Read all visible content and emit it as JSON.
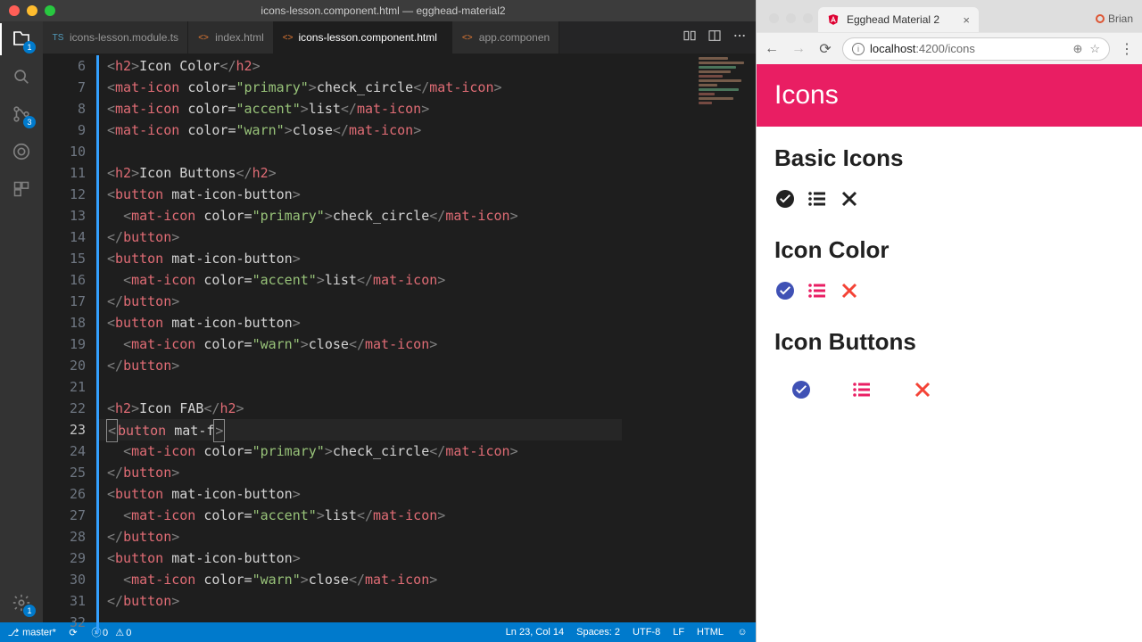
{
  "vscode": {
    "title": "icons-lesson.component.html — egghead-material2",
    "activity_badges": {
      "explorer": "1",
      "scm": "3",
      "gear": "1"
    },
    "tabs": [
      {
        "label": "icons-lesson.module.ts",
        "kind": "ts",
        "active": false,
        "dirty": false
      },
      {
        "label": "index.html",
        "kind": "html",
        "active": false,
        "dirty": false
      },
      {
        "label": "icons-lesson.component.html",
        "kind": "html",
        "active": true,
        "dirty": true
      },
      {
        "label": "app.componen",
        "kind": "html",
        "active": false,
        "dirty": false
      }
    ],
    "gutter_start": 6,
    "gutter_end": 32,
    "cursor_line": 23,
    "statusbar": {
      "branch": "master*",
      "errors": "0",
      "warnings": "0",
      "cursor": "Ln 23, Col 14",
      "spaces": "Spaces: 2",
      "encoding": "UTF-8",
      "eol": "LF",
      "lang": "HTML"
    }
  },
  "code": {
    "l6": {
      "txt": "Icon Color"
    },
    "l7": {
      "attr": "\"primary\"",
      "txt": "check_circle"
    },
    "l8": {
      "attr": "\"accent\"",
      "txt": "list"
    },
    "l9": {
      "attr": "\"warn\"",
      "txt": "close"
    },
    "l11": {
      "txt": "Icon Buttons"
    },
    "l13": {
      "attr": "\"primary\"",
      "txt": "check_circle"
    },
    "l16": {
      "attr": "\"accent\"",
      "txt": "list"
    },
    "l19": {
      "attr": "\"warn\"",
      "txt": "close"
    },
    "l22": {
      "txt": "Icon FAB"
    },
    "l23": {
      "partial": "mat-f"
    },
    "l24": {
      "attr": "\"primary\"",
      "txt": "check_circle"
    },
    "l27": {
      "attr": "\"accent\"",
      "txt": "list"
    },
    "l30": {
      "attr": "\"warn\"",
      "txt": "close"
    }
  },
  "browser": {
    "tab_title": "Egghead Material 2",
    "user": "Brian",
    "url_host": "localhost",
    "url_port": ":4200",
    "url_path": "/icons",
    "page": {
      "header": "Icons",
      "sections": {
        "basic": "Basic Icons",
        "color": "Icon Color",
        "buttons": "Icon Buttons"
      }
    }
  }
}
